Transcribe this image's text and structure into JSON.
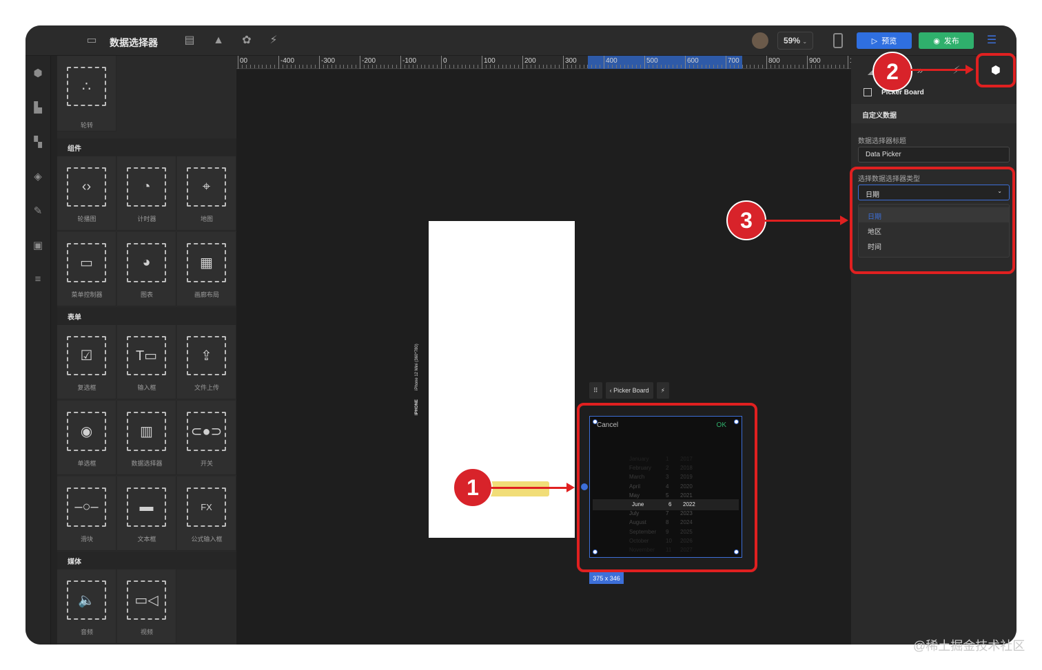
{
  "topbar": {
    "app_title": "数据选择器",
    "zoom": "59%",
    "preview_label": "预览",
    "publish_label": "发布"
  },
  "palette": {
    "cells_top": [
      {
        "label": "轮转"
      }
    ],
    "sections": [
      {
        "title": "组件",
        "items": [
          "轮播图",
          "计时器",
          "地图",
          "菜单控制器",
          "图表",
          "画廊布局"
        ]
      },
      {
        "title": "表单",
        "items": [
          "复选框",
          "输入框",
          "文件上传",
          "单选框",
          "数据选择器",
          "开关",
          "滑块",
          "文本框",
          "公式输入框"
        ]
      },
      {
        "title": "媒体",
        "items": [
          "音频",
          "视频"
        ]
      }
    ]
  },
  "ruler": {
    "ticks": [
      "00",
      "-400",
      "-300",
      "-200",
      "-100",
      "0",
      "100",
      "200",
      "300",
      "400",
      "500",
      "600",
      "700",
      "800",
      "900",
      "1000"
    ]
  },
  "canvas": {
    "device_label": "iPhone 12 Mini (360*780)",
    "device_short": "IPHONE",
    "picker_toolbar_title": "Picker Board",
    "picker": {
      "cancel": "Cancel",
      "ok": "OK",
      "rows": [
        {
          "m": "January",
          "d": "1",
          "y": "2017"
        },
        {
          "m": "February",
          "d": "2",
          "y": "2018"
        },
        {
          "m": "March",
          "d": "3",
          "y": "2019"
        },
        {
          "m": "April",
          "d": "4",
          "y": "2020"
        },
        {
          "m": "May",
          "d": "5",
          "y": "2021"
        },
        {
          "m": "June",
          "d": "6",
          "y": "2022"
        },
        {
          "m": "July",
          "d": "7",
          "y": "2023"
        },
        {
          "m": "August",
          "d": "8",
          "y": "2024"
        },
        {
          "m": "September",
          "d": "9",
          "y": "2025"
        },
        {
          "m": "October",
          "d": "10",
          "y": "2026"
        },
        {
          "m": "November",
          "d": "11",
          "y": "2027"
        }
      ],
      "selected_index": 5
    },
    "size_tag": "375 x 346"
  },
  "rightpanel": {
    "component_name": "Picker Board",
    "section_title": "自定义数据",
    "title_label": "数据选择器标题",
    "title_value": "Data Picker",
    "type_label": "选择数据选择器类型",
    "type_value": "日期",
    "options": [
      "日期",
      "地区",
      "时间"
    ],
    "selected_option": "日期"
  },
  "annotations": [
    "1",
    "2",
    "3"
  ],
  "watermark": "@稀土掘金技术社区",
  "colors": {
    "accent": "#3d6fd8",
    "annotation": "#e02020",
    "publish": "#2fb06c"
  }
}
